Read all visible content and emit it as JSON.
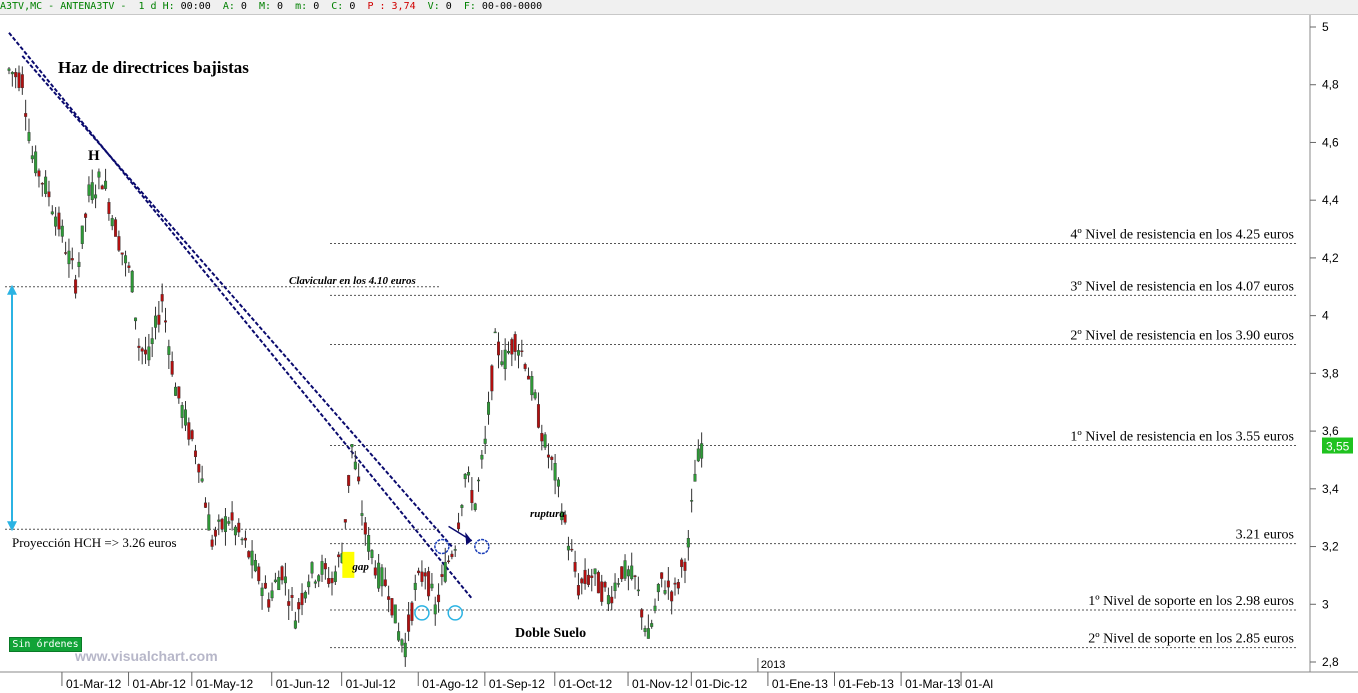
{
  "infobar": {
    "symbol": "A3TV,MC - ANTENA3TV -",
    "period": "1 d",
    "h_label": "H:",
    "h_value": "00:00",
    "a_label": "A:",
    "a_value": "0",
    "m_label": "M:",
    "m_value": "0",
    "m2_label": "m:",
    "m2_value": "0",
    "c_label": "C:",
    "c_value": "0",
    "p_label": "P :",
    "p_value": "3,74",
    "v_label": "V:",
    "v_value": "0",
    "f_label": "F:",
    "f_value": "00-00-0000"
  },
  "colors": {
    "up": "#2e9a37",
    "down": "#b30f0f",
    "lines": "#0a0a6e",
    "cyan": "#2bb3e3",
    "price_tag": "#1fc21f"
  },
  "status": {
    "orders": "Sin órdenes",
    "brand": "www.visualchart.com"
  },
  "chart_data": {
    "type": "candlestick",
    "title": "Haz de directrices bajistas",
    "ylim": [
      2.8,
      5.0
    ],
    "y_ticks": [
      "5",
      "4,8",
      "4,6",
      "4,4",
      "4,2",
      "4",
      "3,8",
      "3,6",
      "3,4",
      "3,2",
      "3",
      "2,8"
    ],
    "y_tick_values": [
      5.0,
      4.8,
      4.6,
      4.4,
      4.2,
      4.0,
      3.8,
      3.6,
      3.4,
      3.2,
      3.0,
      2.8
    ],
    "x_ticks": [
      "01-Mar-12",
      "01-Abr-12",
      "01-May-12",
      "01-Jun-12",
      "01-Jul-12",
      "01-Ago-12",
      "01-Sep-12",
      "01-Oct-12",
      "01-Nov-12",
      "01-Dic-12",
      "01-Ene-13",
      "01-Feb-13",
      "01-Mar-13",
      "01-Al"
    ],
    "x_tick_index": [
      18,
      38,
      57,
      81,
      102,
      125,
      145,
      166,
      188,
      207,
      230,
      250,
      270,
      288
    ],
    "year_marker": {
      "label": "2013",
      "index": 227
    },
    "last_price": "3,55",
    "close_path": [
      [
        0,
        4.85
      ],
      [
        4,
        4.82
      ],
      [
        7,
        4.55
      ],
      [
        12,
        4.42
      ],
      [
        16,
        4.28
      ],
      [
        20,
        4.12
      ],
      [
        24,
        4.42
      ],
      [
        28,
        4.48
      ],
      [
        31,
        4.35
      ],
      [
        34,
        4.22
      ],
      [
        37,
        4.12
      ],
      [
        39,
        3.9
      ],
      [
        42,
        3.85
      ],
      [
        46,
        4.06
      ],
      [
        50,
        3.75
      ],
      [
        54,
        3.6
      ],
      [
        57,
        3.5
      ],
      [
        61,
        3.22
      ],
      [
        66,
        3.3
      ],
      [
        71,
        3.2
      ],
      [
        74,
        3.12
      ],
      [
        78,
        3.02
      ],
      [
        82,
        3.12
      ],
      [
        86,
        2.96
      ],
      [
        90,
        3.1
      ],
      [
        94,
        3.12
      ],
      [
        97,
        3.08
      ],
      [
        100,
        3.18
      ],
      [
        103,
        3.55
      ],
      [
        107,
        3.25
      ],
      [
        111,
        3.1
      ],
      [
        114,
        3.06
      ],
      [
        117,
        2.9
      ],
      [
        119,
        2.86
      ],
      [
        122,
        3.05
      ],
      [
        125,
        3.12
      ],
      [
        128,
        2.98
      ],
      [
        131,
        3.12
      ],
      [
        134,
        3.22
      ],
      [
        137,
        3.45
      ],
      [
        140,
        3.35
      ],
      [
        143,
        3.55
      ],
      [
        146,
        3.9
      ],
      [
        149,
        3.85
      ],
      [
        152,
        3.92
      ],
      [
        155,
        3.85
      ],
      [
        158,
        3.7
      ],
      [
        161,
        3.55
      ],
      [
        164,
        3.45
      ],
      [
        168,
        3.22
      ],
      [
        171,
        3.06
      ],
      [
        175,
        3.1
      ],
      [
        180,
        3.02
      ],
      [
        184,
        3.12
      ],
      [
        188,
        3.08
      ],
      [
        192,
        2.88
      ],
      [
        196,
        3.08
      ],
      [
        200,
        3.04
      ],
      [
        204,
        3.2
      ],
      [
        206,
        3.45
      ],
      [
        208,
        3.55
      ]
    ],
    "levels": [
      {
        "label": "4º Nivel de resistencia en los 4.25 euros",
        "value": 4.25
      },
      {
        "label": "3º Nivel de resistencia en los 4.07 euros",
        "value": 4.07
      },
      {
        "label": "2º Nivel de resistencia en los 3.90 euros",
        "value": 3.9
      },
      {
        "label": "1º Nivel de resistencia en los 3.55 euros",
        "value": 3.55
      },
      {
        "label": "3.21 euros",
        "value": 3.21
      },
      {
        "label": "1º Nivel de soporte en los 2.98 euros",
        "value": 2.98
      },
      {
        "label": "2º Nivel de soporte en los 2.85 euros",
        "value": 2.85
      }
    ],
    "trendlines": [
      {
        "from": [
          0,
          4.98
        ],
        "to": [
          139,
          3.02
        ]
      },
      {
        "from": [
          4,
          4.9
        ],
        "to": [
          133,
          3.2
        ]
      }
    ],
    "annotations": {
      "H": "H",
      "clavicular": "Clavicular en los 4.10 euros",
      "clavicular_value": 4.1,
      "projection": "Proyección HCH => 3.26 euros",
      "projection_value": 3.26,
      "gap": "gap",
      "ruptura": "ruptura",
      "double_bottom": "Doble Suelo"
    }
  }
}
